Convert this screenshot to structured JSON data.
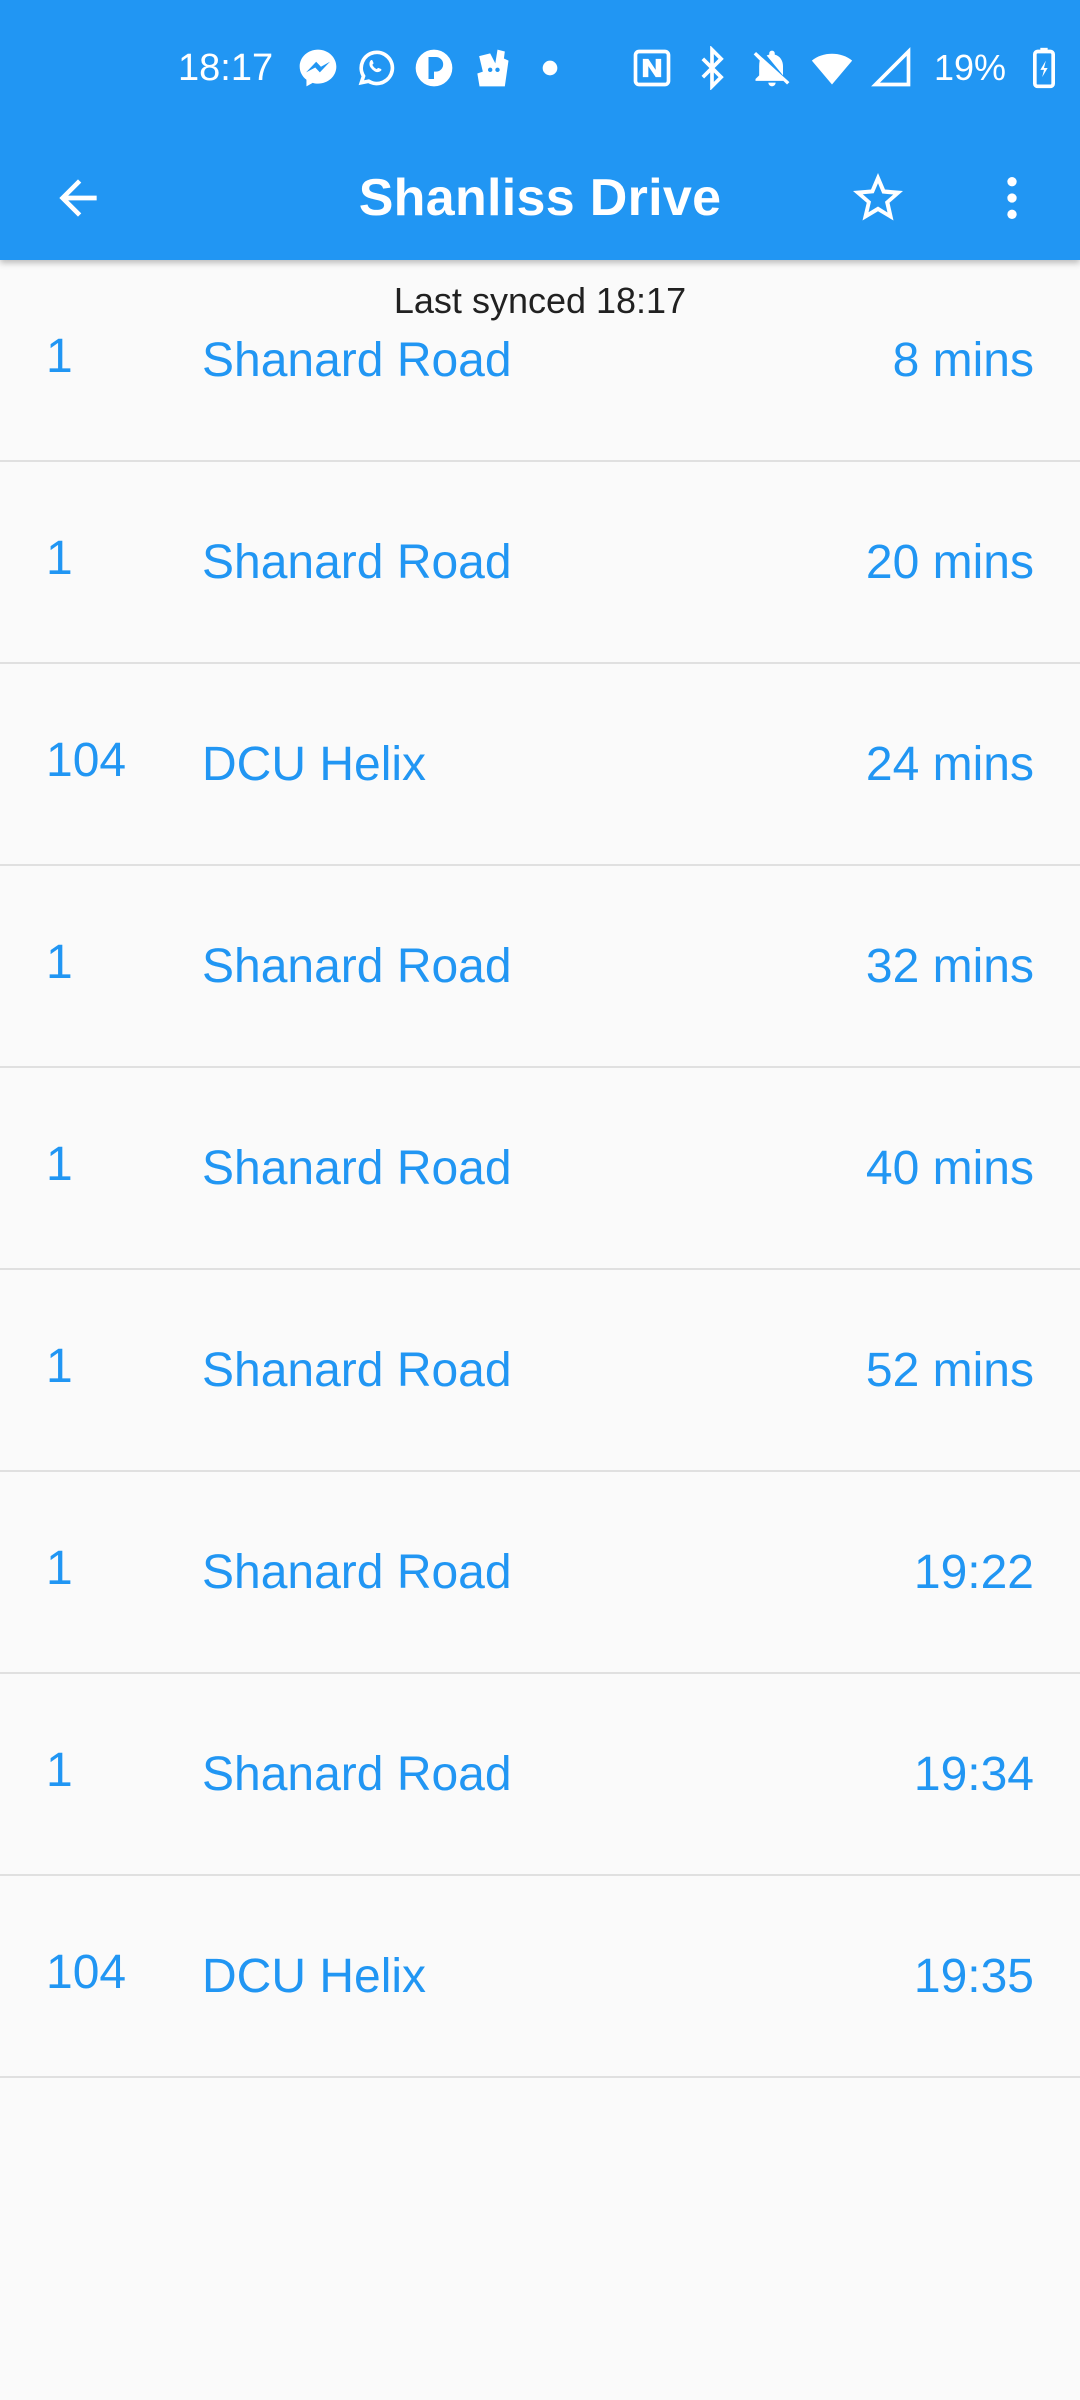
{
  "status_bar": {
    "time": "18:17",
    "battery": "19%",
    "left_icons": [
      "messenger-icon",
      "whatsapp-icon",
      "app-icon",
      "deliveroo-icon",
      "dot-icon"
    ],
    "right_icons": [
      "nfc-icon",
      "bluetooth-icon",
      "bell-off-icon",
      "wifi-icon",
      "signal-icon",
      "battery-icon"
    ]
  },
  "toolbar": {
    "title": "Shanliss Drive",
    "back_icon": "arrow-back-icon",
    "favorite_icon": "star-outline-icon",
    "more_icon": "more-vert-icon"
  },
  "sync_text": "Last synced 18:17",
  "departures": [
    {
      "route": "1",
      "destination": "Shanard Road",
      "due": "8 mins"
    },
    {
      "route": "1",
      "destination": "Shanard Road",
      "due": "20 mins"
    },
    {
      "route": "104",
      "destination": "DCU Helix",
      "due": "24 mins"
    },
    {
      "route": "1",
      "destination": "Shanard Road",
      "due": "32 mins"
    },
    {
      "route": "1",
      "destination": "Shanard Road",
      "due": "40 mins"
    },
    {
      "route": "1",
      "destination": "Shanard Road",
      "due": "52 mins"
    },
    {
      "route": "1",
      "destination": "Shanard Road",
      "due": "19:22"
    },
    {
      "route": "1",
      "destination": "Shanard Road",
      "due": "19:34"
    },
    {
      "route": "104",
      "destination": "DCU Helix",
      "due": "19:35"
    }
  ],
  "colors": {
    "primary": "#2196f3",
    "background": "#fafafa",
    "divider": "#e0e0e0"
  }
}
